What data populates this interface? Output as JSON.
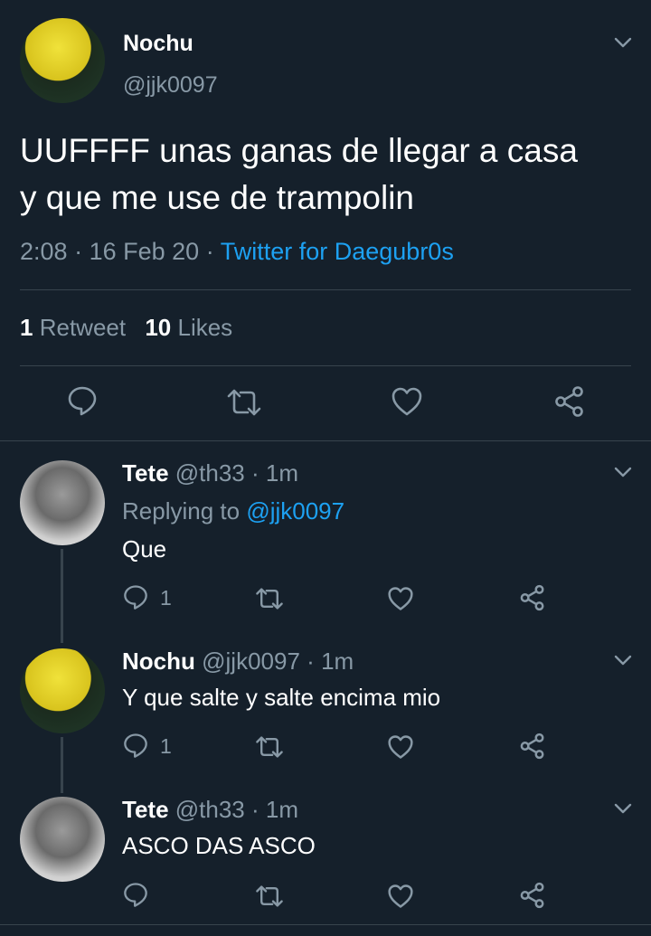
{
  "main_tweet": {
    "name": "Nochu",
    "handle": "@jjk0097",
    "text_line1": "UUFFFF unas ganas de llegar a casa",
    "text_line2": "y que me use de trampolin",
    "time": "2:08",
    "sep1": "·",
    "date": "16 Feb 20",
    "sep2": "·",
    "client": "Twitter for Daegubr0s",
    "retweets_count": "1",
    "retweets_label": "Retweet",
    "likes_count": "10",
    "likes_label": "Likes"
  },
  "replies": [
    {
      "name": "Tete",
      "handle": "@th33",
      "sep": "·",
      "age": "1m",
      "replying_prefix": "Replying to",
      "replying_to": "@jjk0097",
      "text": "Que",
      "reply_count": "1"
    },
    {
      "name": "Nochu",
      "handle": "@jjk0097",
      "sep": "·",
      "age": "1m",
      "text": "Y que salte y salte encima mio",
      "reply_count": "1"
    },
    {
      "name": "Tete",
      "handle": "@th33",
      "sep": "·",
      "age": "1m",
      "text": "ASCO DAS ASCO",
      "reply_count": ""
    }
  ],
  "colors": {
    "background": "#15202b",
    "text": "#ffffff",
    "muted": "#8899a6",
    "link": "#1da1f2",
    "divider": "#38444d"
  },
  "icons": [
    "chevron-down-icon",
    "reply-icon",
    "retweet-icon",
    "like-icon",
    "share-icon"
  ]
}
